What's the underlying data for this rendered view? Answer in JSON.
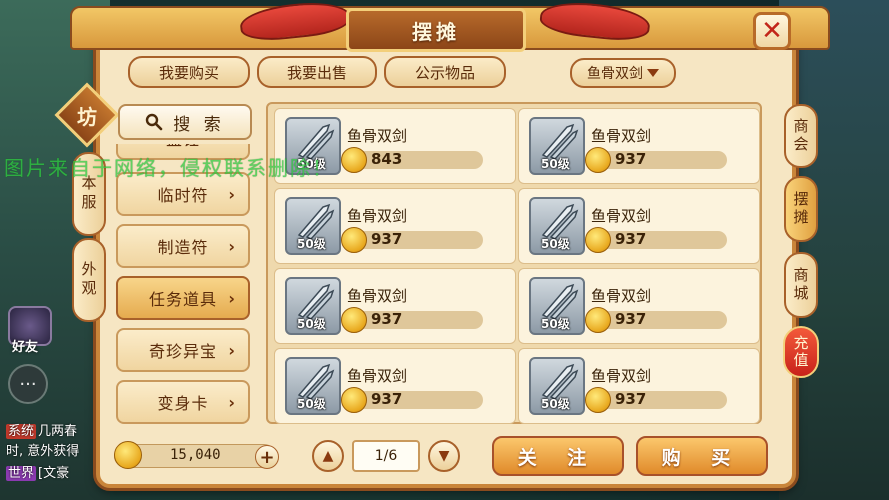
{
  "window": {
    "title": "摆摊"
  },
  "tabs": {
    "buy": "我要购买",
    "sell": "我要出售",
    "public": "公示物品"
  },
  "filter": {
    "selected": "鱼骨双剑"
  },
  "side": {
    "badge": "坊",
    "server": "本服",
    "appearance": "外观"
  },
  "search": {
    "label": "搜 索"
  },
  "categories": [
    {
      "label": "临时符"
    },
    {
      "label": "制造符"
    },
    {
      "label": "任务道具",
      "selected": true
    },
    {
      "label": "奇珍异宝"
    },
    {
      "label": "变身卡"
    }
  ],
  "partial_category": "盛钰",
  "items": [
    {
      "name": "鱼骨双剑",
      "level": "50级",
      "price": "843"
    },
    {
      "name": "鱼骨双剑",
      "level": "50级",
      "price": "937"
    },
    {
      "name": "鱼骨双剑",
      "level": "50级",
      "price": "937"
    },
    {
      "name": "鱼骨双剑",
      "level": "50级",
      "price": "937"
    },
    {
      "name": "鱼骨双剑",
      "level": "50级",
      "price": "937"
    },
    {
      "name": "鱼骨双剑",
      "level": "50级",
      "price": "937"
    },
    {
      "name": "鱼骨双剑",
      "level": "50级",
      "price": "937"
    },
    {
      "name": "鱼骨双剑",
      "level": "50级",
      "price": "937"
    }
  ],
  "balance": "15,040",
  "pager": {
    "indicator": "1/6"
  },
  "actions": {
    "follow": "关 注",
    "buy": "购 买"
  },
  "right_tabs": {
    "guild": "商会",
    "stall": "摆摊",
    "mall": "商城",
    "recharge": "充值"
  },
  "hud": {
    "friends": "好友",
    "chat": [
      {
        "tag": "系统",
        "text": "几两春"
      },
      {
        "tag": "",
        "text": "时, 意外获得"
      },
      {
        "tag": "世界",
        "text": "[文豪"
      }
    ]
  },
  "watermark": "图片来自于网络，侵权联系删除！",
  "colors": {
    "panel": "#f6e6c3",
    "accent": "#c9853a",
    "title_bg": "#8c4618",
    "close": "#c2261a",
    "watermark": "#2ecc40"
  }
}
